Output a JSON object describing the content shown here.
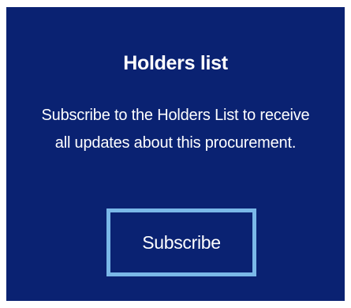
{
  "card": {
    "title": "Holders list",
    "description": "Subscribe to the Holders List to receive all updates about this procurement.",
    "subscribe_label": "Subscribe",
    "colors": {
      "background": "#0a2272",
      "text": "#ffffff",
      "button_border": "#7ab8e8"
    }
  }
}
